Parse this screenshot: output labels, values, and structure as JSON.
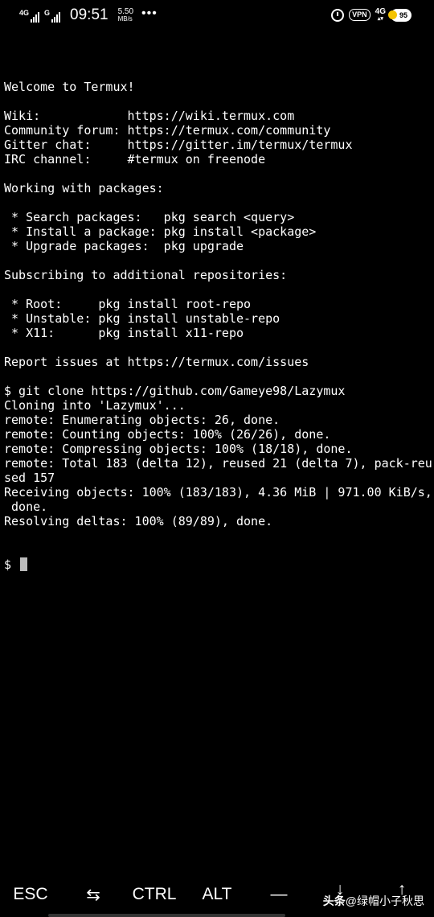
{
  "status_bar": {
    "sim1_label": "4G",
    "sim2_label": "G",
    "time": "09:51",
    "net_speed_value": "5.50",
    "net_speed_unit": "MB/s",
    "more_dots": "•••",
    "vpn_label": "VPN",
    "network_type": "4G",
    "battery_level": "95"
  },
  "terminal": {
    "lines": [
      "Welcome to Termux!",
      "",
      "Wiki:            https://wiki.termux.com",
      "Community forum: https://termux.com/community",
      "Gitter chat:     https://gitter.im/termux/termux",
      "IRC channel:     #termux on freenode",
      "",
      "Working with packages:",
      "",
      " * Search packages:   pkg search <query>",
      " * Install a package: pkg install <package>",
      " * Upgrade packages:  pkg upgrade",
      "",
      "Subscribing to additional repositories:",
      "",
      " * Root:     pkg install root-repo",
      " * Unstable: pkg install unstable-repo",
      " * X11:      pkg install x11-repo",
      "",
      "Report issues at https://termux.com/issues",
      "",
      "$ git clone https://github.com/Gameye98/Lazymux",
      "Cloning into 'Lazymux'...",
      "remote: Enumerating objects: 26, done.",
      "remote: Counting objects: 100% (26/26), done.",
      "remote: Compressing objects: 100% (18/18), done.",
      "remote: Total 183 (delta 12), reused 21 (delta 7), pack-reu",
      "sed 157",
      "Receiving objects: 100% (183/183), 4.36 MiB | 971.00 KiB/s,",
      " done.",
      "Resolving deltas: 100% (89/89), done."
    ],
    "prompt": "$ "
  },
  "extra_keys": {
    "esc": "ESC",
    "tab": "⇆",
    "ctrl": "CTRL",
    "alt": "ALT",
    "dash": "—",
    "down": "↓",
    "up": "↑"
  },
  "watermark": {
    "brand": "头条",
    "handle": "@绿帽小子秋思"
  }
}
